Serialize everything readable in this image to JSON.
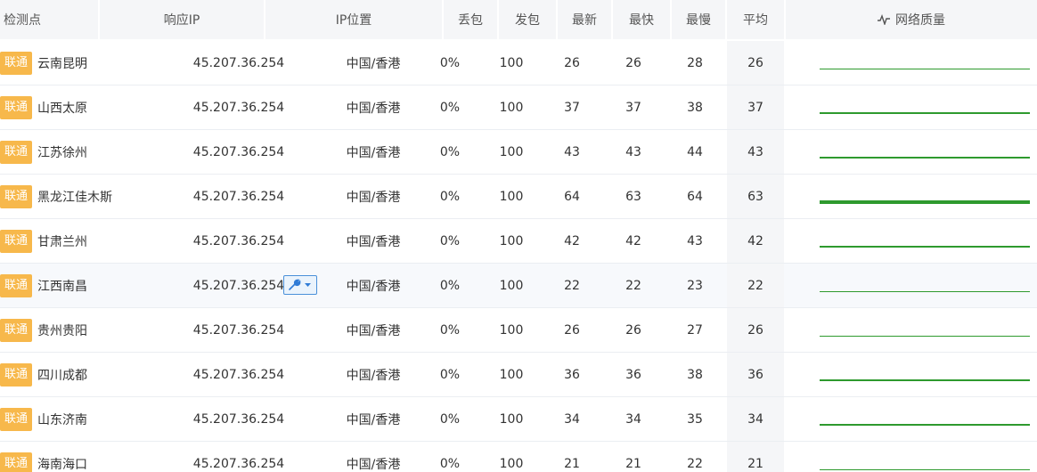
{
  "headers": {
    "node": "检测点",
    "ip": "响应IP",
    "location": "IP位置",
    "loss": "丢包",
    "sent": "发包",
    "latest": "最新",
    "fastest": "最快",
    "slowest": "最慢",
    "avg": "平均",
    "quality": "网络质量"
  },
  "icons": {
    "quality_header": "pulse-icon",
    "row_tool": "wrench-dropdown-icon"
  },
  "colors": {
    "badge": "#f7b84b",
    "quality_line": "#2e9a2e",
    "header_bg": "#f5f6f8",
    "highlight_row": "#f7f9fc",
    "tool_border": "#4a90d9"
  },
  "rows": [
    {
      "isp": "联通",
      "node": "云南昆明",
      "ip": "45.207.36.254",
      "location": "中国/香港",
      "loss": "0%",
      "sent": "100",
      "latest": "26",
      "fastest": "26",
      "slowest": "28",
      "avg": "26",
      "quality_weight": 1
    },
    {
      "isp": "联通",
      "node": "山西太原",
      "ip": "45.207.36.254",
      "location": "中国/香港",
      "loss": "0%",
      "sent": "100",
      "latest": "37",
      "fastest": "37",
      "slowest": "38",
      "avg": "37",
      "quality_weight": 2
    },
    {
      "isp": "联通",
      "node": "江苏徐州",
      "ip": "45.207.36.254",
      "location": "中国/香港",
      "loss": "0%",
      "sent": "100",
      "latest": "43",
      "fastest": "43",
      "slowest": "44",
      "avg": "43",
      "quality_weight": 2
    },
    {
      "isp": "联通",
      "node": "黑龙江佳木斯",
      "ip": "45.207.36.254",
      "location": "中国/香港",
      "loss": "0%",
      "sent": "100",
      "latest": "64",
      "fastest": "63",
      "slowest": "64",
      "avg": "63",
      "quality_weight": 4
    },
    {
      "isp": "联通",
      "node": "甘肃兰州",
      "ip": "45.207.36.254",
      "location": "中国/香港",
      "loss": "0%",
      "sent": "100",
      "latest": "42",
      "fastest": "42",
      "slowest": "43",
      "avg": "42",
      "quality_weight": 2
    },
    {
      "isp": "联通",
      "node": "江西南昌",
      "ip": "45.207.36.254",
      "location": "中国/香港",
      "loss": "0%",
      "sent": "100",
      "latest": "22",
      "fastest": "22",
      "slowest": "23",
      "avg": "22",
      "quality_weight": 1,
      "highlight": true,
      "tool": true
    },
    {
      "isp": "联通",
      "node": "贵州贵阳",
      "ip": "45.207.36.254",
      "location": "中国/香港",
      "loss": "0%",
      "sent": "100",
      "latest": "26",
      "fastest": "26",
      "slowest": "27",
      "avg": "26",
      "quality_weight": 1
    },
    {
      "isp": "联通",
      "node": "四川成都",
      "ip": "45.207.36.254",
      "location": "中国/香港",
      "loss": "0%",
      "sent": "100",
      "latest": "36",
      "fastest": "36",
      "slowest": "38",
      "avg": "36",
      "quality_weight": 2
    },
    {
      "isp": "联通",
      "node": "山东济南",
      "ip": "45.207.36.254",
      "location": "中国/香港",
      "loss": "0%",
      "sent": "100",
      "latest": "34",
      "fastest": "34",
      "slowest": "35",
      "avg": "34",
      "quality_weight": 2
    },
    {
      "isp": "联通",
      "node": "海南海口",
      "ip": "45.207.36.254",
      "location": "中国/香港",
      "loss": "0%",
      "sent": "100",
      "latest": "21",
      "fastest": "21",
      "slowest": "22",
      "avg": "21",
      "quality_weight": 1
    }
  ]
}
